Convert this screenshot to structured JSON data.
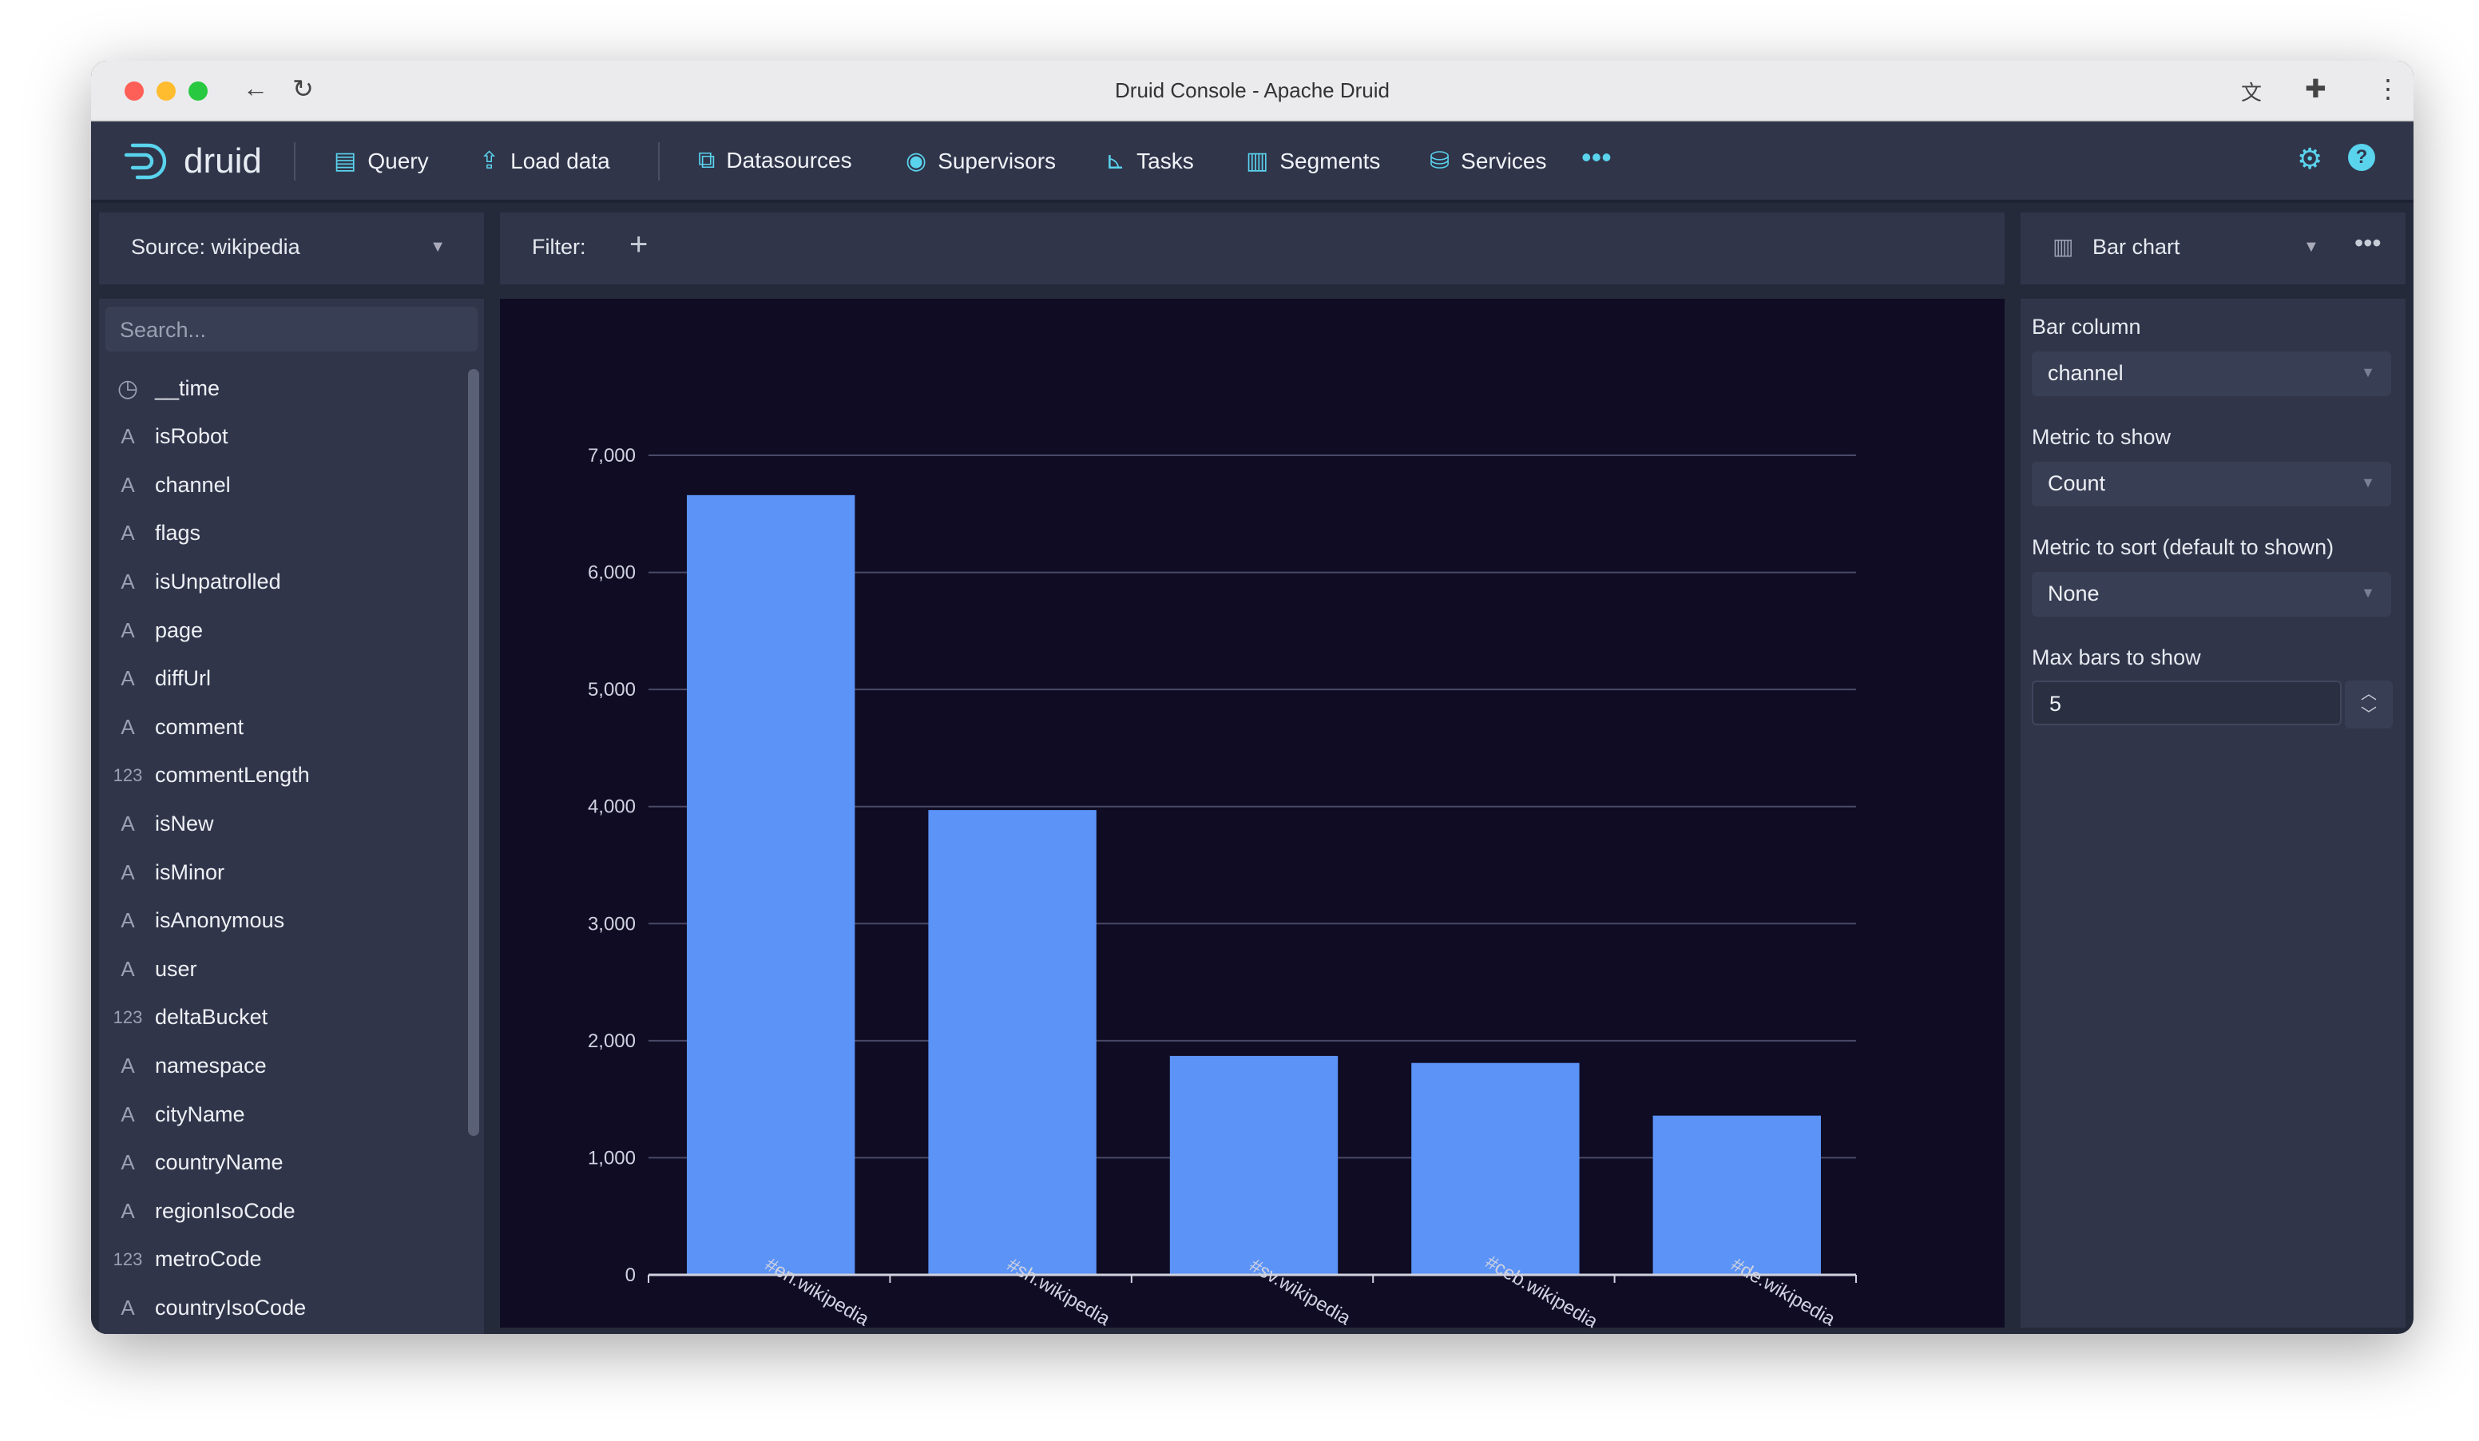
{
  "window": {
    "title": "Druid Console - Apache Druid"
  },
  "nav": {
    "logo": "druid",
    "items": [
      {
        "label": "Query",
        "icon": "query-icon"
      },
      {
        "label": "Load data",
        "icon": "upload-icon"
      },
      {
        "label": "Datasources",
        "icon": "datasources-icon"
      },
      {
        "label": "Supervisors",
        "icon": "eye-icon"
      },
      {
        "label": "Tasks",
        "icon": "tasks-icon"
      },
      {
        "label": "Segments",
        "icon": "segments-icon"
      },
      {
        "label": "Services",
        "icon": "database-icon"
      }
    ]
  },
  "source": {
    "label": "Source: wikipedia"
  },
  "search": {
    "placeholder": "Search..."
  },
  "columns": [
    {
      "name": "__time",
      "type": "time"
    },
    {
      "name": "isRobot",
      "type": "A"
    },
    {
      "name": "channel",
      "type": "A"
    },
    {
      "name": "flags",
      "type": "A"
    },
    {
      "name": "isUnpatrolled",
      "type": "A"
    },
    {
      "name": "page",
      "type": "A"
    },
    {
      "name": "diffUrl",
      "type": "A"
    },
    {
      "name": "comment",
      "type": "A"
    },
    {
      "name": "commentLength",
      "type": "123"
    },
    {
      "name": "isNew",
      "type": "A"
    },
    {
      "name": "isMinor",
      "type": "A"
    },
    {
      "name": "isAnonymous",
      "type": "A"
    },
    {
      "name": "user",
      "type": "A"
    },
    {
      "name": "deltaBucket",
      "type": "123"
    },
    {
      "name": "namespace",
      "type": "A"
    },
    {
      "name": "cityName",
      "type": "A"
    },
    {
      "name": "countryName",
      "type": "A"
    },
    {
      "name": "regionIsoCode",
      "type": "A"
    },
    {
      "name": "metroCode",
      "type": "123"
    },
    {
      "name": "countryIsoCode",
      "type": "A"
    }
  ],
  "filter": {
    "label": "Filter:"
  },
  "viz": {
    "type": "Bar chart"
  },
  "controls": {
    "bar_column_label": "Bar column",
    "bar_column": "channel",
    "metric_label": "Metric to show",
    "metric": "Count",
    "sort_label": "Metric to sort (default to shown)",
    "sort": "None",
    "max_label": "Max bars to show",
    "max": "5"
  },
  "colors": {
    "bar": "#5b93f7",
    "chart_bg": "#0f0c24",
    "accent": "#5ad3ed"
  },
  "chart_data": {
    "type": "bar",
    "categories": [
      "#en.wikipedia",
      "#sh.wikipedia",
      "#sv.wikipedia",
      "#ceb.wikipedia",
      "#de.wikipedia"
    ],
    "values": [
      6660,
      3970,
      1870,
      1810,
      1360
    ],
    "ylim": [
      0,
      7000
    ],
    "yticks": [
      "0",
      "1,000",
      "2,000",
      "3,000",
      "4,000",
      "5,000",
      "6,000",
      "7,000"
    ],
    "grid": true
  }
}
